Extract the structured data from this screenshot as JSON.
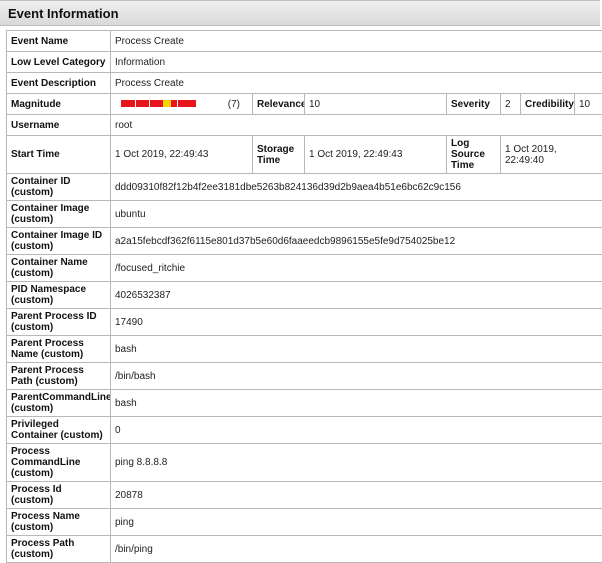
{
  "header": {
    "title": "Event Information"
  },
  "event_name": {
    "label": "Event Name",
    "value": "Process Create"
  },
  "low_level_category": {
    "label": "Low Level Category",
    "value": "Information"
  },
  "event_description": {
    "label": "Event Description",
    "value": "Process Create"
  },
  "magnitude": {
    "label": "Magnitude",
    "value_text": "(7)",
    "level": 0.7
  },
  "relevance": {
    "label": "Relevance",
    "value": "10"
  },
  "severity": {
    "label": "Severity",
    "value": "2"
  },
  "credibility": {
    "label": "Credibility",
    "value": "10"
  },
  "username": {
    "label": "Username",
    "value": "root"
  },
  "start_time": {
    "label": "Start Time",
    "value": "1 Oct 2019, 22:49:43"
  },
  "storage_time": {
    "label": "Storage Time",
    "value": "1 Oct 2019, 22:49:43"
  },
  "log_source_time": {
    "label": "Log Source Time",
    "value": "1 Oct 2019, 22:49:40"
  },
  "custom_rows": [
    {
      "label": "Container ID (custom)",
      "value": "ddd09310f82f12b4f2ee3181dbe5263b824136d39d2b9aea4b51e6bc62c9c156"
    },
    {
      "label": "Container Image (custom)",
      "value": "ubuntu"
    },
    {
      "label": "Container Image ID (custom)",
      "value": "a2a15febcdf362f6115e801d37b5e60d6faaeedcb9896155e5fe9d754025be12"
    },
    {
      "label": "Container Name (custom)",
      "value": "/focused_ritchie"
    },
    {
      "label": "PID Namespace (custom)",
      "value": "4026532387"
    },
    {
      "label": "Parent Process ID (custom)",
      "value": "17490"
    },
    {
      "label": "Parent Process Name (custom)",
      "value": "bash"
    },
    {
      "label": "Parent Process Path (custom)",
      "value": "/bin/bash"
    },
    {
      "label": "ParentCommandLine (custom)",
      "value": "bash"
    },
    {
      "label": "Privileged Container (custom)",
      "value": "0"
    },
    {
      "label": "Process CommandLine (custom)",
      "value": "ping 8.8.8.8"
    },
    {
      "label": "Process Id (custom)",
      "value": "20878"
    },
    {
      "label": "Process Name (custom)",
      "value": "ping"
    },
    {
      "label": "Process Path (custom)",
      "value": "/bin/ping"
    }
  ]
}
